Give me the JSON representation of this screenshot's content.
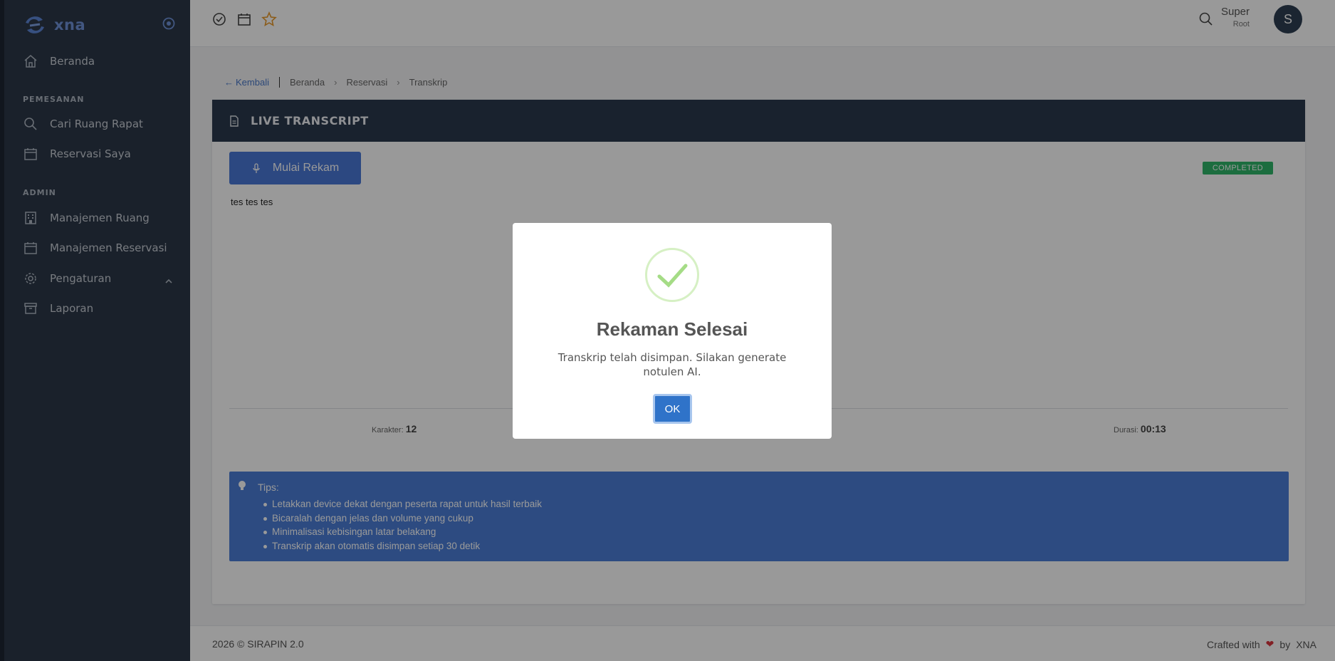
{
  "brand": {
    "name": "xna"
  },
  "sidebar": {
    "items_top": [
      {
        "label": "Beranda",
        "icon": "home-icon"
      }
    ],
    "section_booking": "PEMESANAN",
    "booking_items": [
      {
        "label": "Cari Ruang Rapat",
        "icon": "search-icon"
      },
      {
        "label": "Reservasi Saya",
        "icon": "calendar-icon"
      }
    ],
    "section_admin": "ADMIN",
    "admin_items": [
      {
        "label": "Manajemen Ruang",
        "icon": "building-icon"
      },
      {
        "label": "Manajemen Reservasi",
        "icon": "calendar-icon"
      },
      {
        "label": "Pengaturan",
        "icon": "gear-icon"
      },
      {
        "label": "Laporan",
        "icon": "archive-icon"
      }
    ]
  },
  "topbar": {
    "user_first": "Super",
    "user_role": "Root",
    "avatar_letter": "S"
  },
  "breadcrumb": {
    "back": "Kembali",
    "items": [
      "Beranda",
      "Reservasi",
      "Transkrip"
    ]
  },
  "card": {
    "title": "LIVE TRANSCRIPT",
    "record_button": "Mulai Rekam",
    "status_badge": "COMPLETED",
    "transcript_text": "tes tes tes",
    "chars_label": "Karakter:",
    "chars_value": "12",
    "duration_label": "Durasi:",
    "duration_value": "00:13"
  },
  "tips": {
    "title": "Tips:",
    "items": [
      "Letakkan device dekat dengan peserta rapat untuk hasil terbaik",
      "Bicaralah dengan jelas dan volume yang cukup",
      "Minimalisasi kebisingan latar belakang",
      "Transkrip akan otomatis disimpan setiap 30 detik"
    ]
  },
  "footer": {
    "left": "2026 © SIRAPIN 2.0",
    "crafted": "Crafted with",
    "by": "by",
    "brand": "XNA"
  },
  "modal": {
    "title": "Rekaman Selesai",
    "message": "Transkrip telah disimpan. Silakan generate notulen AI.",
    "ok": "OK"
  },
  "colors": {
    "sidebar": "#2c3848",
    "accent": "#4a79d8",
    "success": "#2fb66a",
    "heart": "#d9363e"
  }
}
